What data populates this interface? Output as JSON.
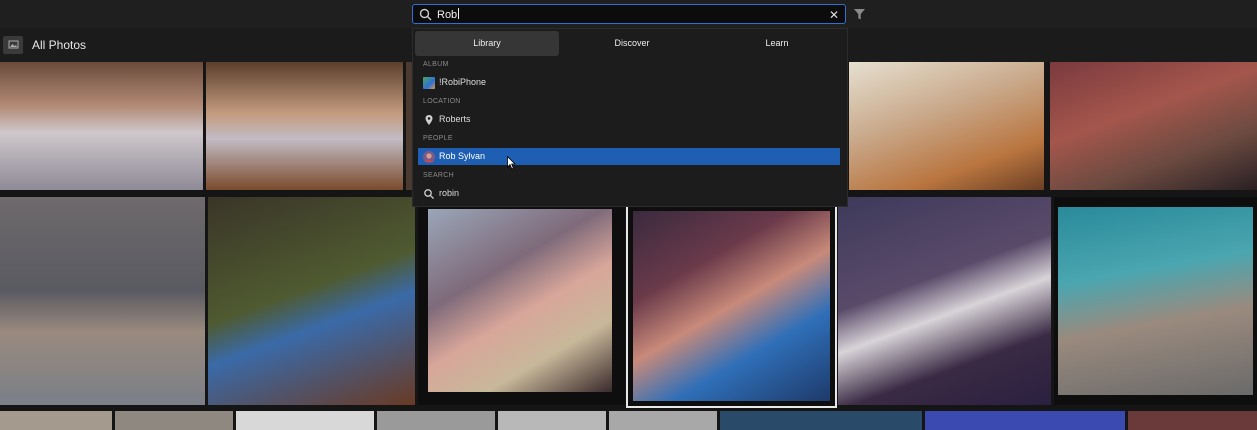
{
  "search": {
    "query": "Rob"
  },
  "subbar": {
    "title": "All Photos"
  },
  "tabs": [
    {
      "label": "Library",
      "active": true
    },
    {
      "label": "Discover",
      "active": false
    },
    {
      "label": "Learn",
      "active": false
    }
  ],
  "sections": [
    {
      "heading": "ALBUM",
      "items": [
        {
          "label": "!RobiPhone",
          "icon": "album-thumbnail-icon"
        }
      ]
    },
    {
      "heading": "LOCATION",
      "items": [
        {
          "label": "Roberts",
          "icon": "location-pin-icon"
        }
      ]
    },
    {
      "heading": "PEOPLE",
      "items": [
        {
          "label": "Rob Sylvan",
          "icon": "person-avatar-icon",
          "highlighted": true
        }
      ]
    },
    {
      "heading": "SEARCH",
      "items": [
        {
          "label": "robin",
          "icon": "search-icon"
        }
      ]
    }
  ],
  "colors": {
    "accent": "#2f6fd6",
    "highlight": "#1e5fb4",
    "background": "#151515"
  }
}
